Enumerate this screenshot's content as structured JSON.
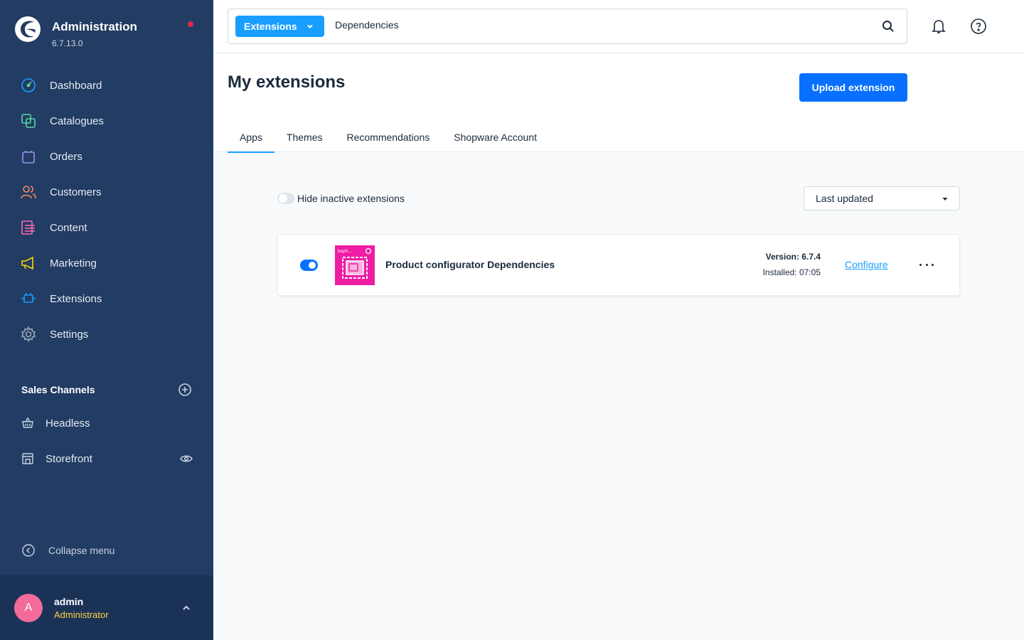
{
  "app": {
    "title": "Administration",
    "version": "6.7.13.0"
  },
  "sidebar": {
    "items": [
      {
        "label": "Dashboard",
        "icon": "dashboard-icon",
        "color": "#57d9a3"
      },
      {
        "label": "Catalogues",
        "icon": "catalogues-icon",
        "color": "#57d9a3"
      },
      {
        "label": "Orders",
        "icon": "orders-icon",
        "color": "#a092f0"
      },
      {
        "label": "Customers",
        "icon": "customers-icon",
        "color": "#f88962"
      },
      {
        "label": "Content",
        "icon": "content-icon",
        "color": "#ff68b4"
      },
      {
        "label": "Marketing",
        "icon": "marketing-icon",
        "color": "#ffd700"
      },
      {
        "label": "Extensions",
        "icon": "extensions-icon",
        "color": "#189eff"
      },
      {
        "label": "Settings",
        "icon": "settings-icon",
        "color": "#9aa8b5"
      }
    ],
    "sales_channels": {
      "title": "Sales Channels",
      "items": [
        {
          "label": "Headless",
          "icon": "basket-icon"
        },
        {
          "label": "Storefront",
          "icon": "storefront-icon"
        }
      ]
    },
    "collapse_label": "Collapse menu",
    "user": {
      "initial": "A",
      "name": "admin",
      "role": "Administrator"
    }
  },
  "topbar": {
    "search_type": "Extensions",
    "search_value": "Dependencies"
  },
  "page": {
    "title": "My extensions",
    "upload_label": "Upload extension",
    "tabs": [
      {
        "label": "Apps",
        "active": true
      },
      {
        "label": "Themes",
        "active": false
      },
      {
        "label": "Recommendations",
        "active": false
      },
      {
        "label": "Shopware Account",
        "active": false
      }
    ]
  },
  "filters": {
    "hide_inactive_label": "Hide inactive extensions",
    "hide_inactive_on": false,
    "sort_value": "Last updated"
  },
  "extension": {
    "name": "Product configurator Dependencies",
    "version": "Version: 6.7.4",
    "installed": "Installed: 07:05",
    "configure_label": "Configure",
    "active": true,
    "logo_text": "bsph..."
  },
  "colors": {
    "sidebar_bg": "#223c63",
    "primary": "#0870ff",
    "accent": "#189eff",
    "logo_pink": "#ee1da4"
  }
}
